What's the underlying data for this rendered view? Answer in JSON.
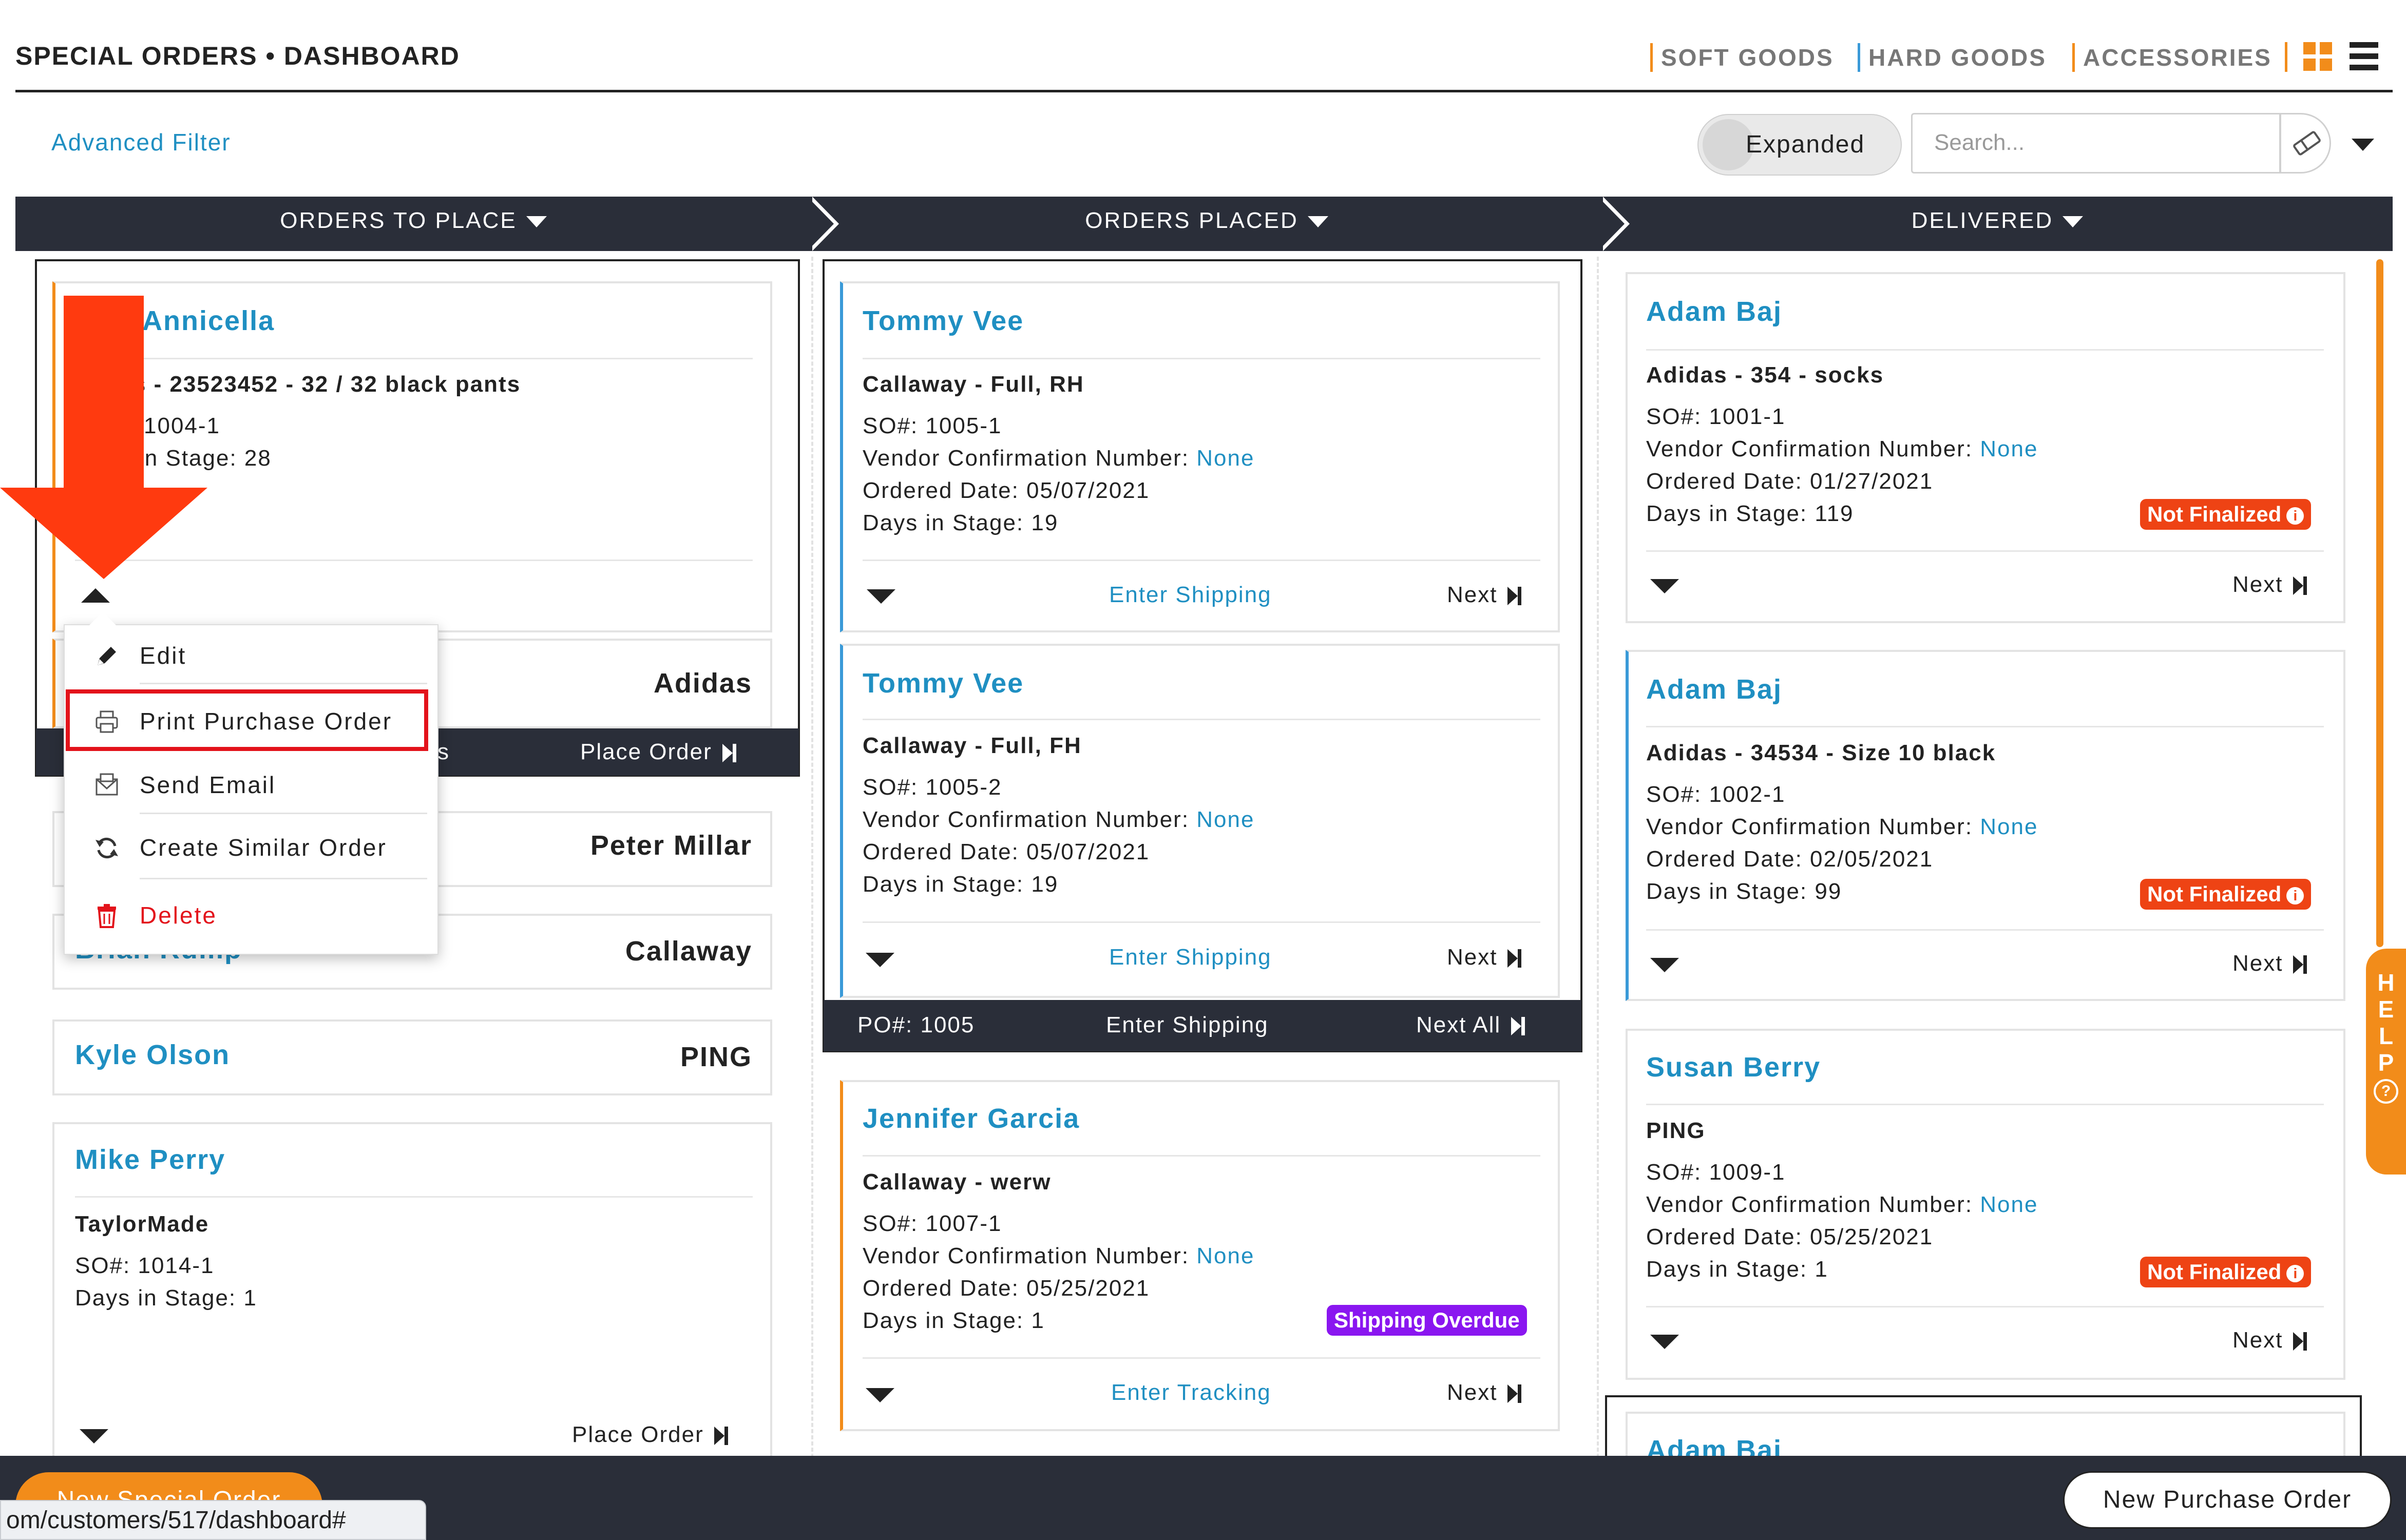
{
  "header": {
    "title": "SPECIAL ORDERS • DASHBOARD",
    "categories": [
      "SOFT GOODS",
      "HARD GOODS",
      "ACCESSORIES"
    ]
  },
  "filter": {
    "advanced_label": "Advanced Filter",
    "toggle_label": "Expanded",
    "search_placeholder": "Search..."
  },
  "stages": [
    {
      "label": "ORDERS TO PLACE"
    },
    {
      "label": "ORDERS PLACED"
    },
    {
      "label": "DELIVERED"
    }
  ],
  "col1": {
    "card1": {
      "name": "s Annicella",
      "product": "ns - 23523452 - 32 / 32 black pants",
      "so": "1004-1",
      "days": "in Stage: 28"
    },
    "group1_vendor": "Adidas",
    "group1_footer_left": "s",
    "group1_footer_action": "Place Order",
    "row_peter": "Peter Millar",
    "row_brian_name": "Brian Rump",
    "row_brian_vendor": "Callaway",
    "row_kyle_name": "Kyle Olson",
    "row_kyle_vendor": "PING",
    "card_mike": {
      "name": "Mike Perry",
      "product": "TaylorMade",
      "so": "SO#: 1014-1",
      "days": "Days in Stage: 1",
      "action": "Place Order"
    }
  },
  "menu": {
    "edit": "Edit",
    "print": "Print Purchase Order",
    "email": "Send Email",
    "similar": "Create Similar Order",
    "delete": "Delete"
  },
  "col2": {
    "card1": {
      "name": "Tommy Vee",
      "product": "Callaway - Full, RH",
      "so": "SO#: 1005-1",
      "vcn_label": "Vendor Confirmation Number: ",
      "vcn_value": "None",
      "ordered": "Ordered Date: 05/07/2021",
      "days": "Days in Stage: 19",
      "link": "Enter Shipping",
      "next": "Next"
    },
    "card2": {
      "name": "Tommy Vee",
      "product": "Callaway - Full, FH",
      "so": "SO#: 1005-2",
      "vcn_label": "Vendor Confirmation Number: ",
      "vcn_value": "None",
      "ordered": "Ordered Date: 05/07/2021",
      "days": "Days in Stage: 19",
      "link": "Enter Shipping",
      "next": "Next"
    },
    "group_footer": {
      "po": "PO#: 1005",
      "link": "Enter Shipping",
      "next": "Next All"
    },
    "card3": {
      "name": "Jennifer Garcia",
      "product": "Callaway - werw",
      "so": "SO#: 1007-1",
      "vcn_label": "Vendor Confirmation Number: ",
      "vcn_value": "None",
      "ordered": "Ordered Date: 05/25/2021",
      "days": "Days in Stage: 1",
      "badge": "Shipping Overdue",
      "link": "Enter Tracking",
      "next": "Next"
    }
  },
  "col3": {
    "card1": {
      "name": "Adam Baj",
      "product": "Adidas - 354 - socks",
      "so": "SO#: 1001-1",
      "vcn_label": "Vendor Confirmation Number: ",
      "vcn_value": "None",
      "ordered": "Ordered Date: 01/27/2021",
      "days": "Days in Stage: 119",
      "badge": "Not Finalized",
      "next": "Next"
    },
    "card2": {
      "name": "Adam Baj",
      "product": "Adidas - 34534 - Size 10 black",
      "so": "SO#: 1002-1",
      "vcn_label": "Vendor Confirmation Number: ",
      "vcn_value": "None",
      "ordered": "Ordered Date: 02/05/2021",
      "days": "Days in Stage: 99",
      "badge": "Not Finalized",
      "next": "Next"
    },
    "card3": {
      "name": "Susan Berry",
      "product": "PING",
      "so": "SO#: 1009-1",
      "vcn_label": "Vendor Confirmation Number: ",
      "vcn_value": "None",
      "ordered": "Ordered Date: 05/25/2021",
      "days": "Days in Stage: 1",
      "badge": "Not Finalized",
      "next": "Next"
    },
    "card4_name": "Adam Baj"
  },
  "help_letters": [
    "H",
    "E",
    "L",
    "P"
  ],
  "footer": {
    "new_special_order": "New Special Order",
    "new_purchase_order": "New Purchase Order",
    "status_url": "om/customers/517/dashboard#"
  },
  "colors": {
    "accent_orange": "#f28c1a",
    "link_blue": "#1f8fc2",
    "dark_bar": "#2a2e39",
    "badge_red": "#ee4314",
    "badge_purple": "#8a16f0",
    "annotation_red": "#ff3a0f"
  }
}
